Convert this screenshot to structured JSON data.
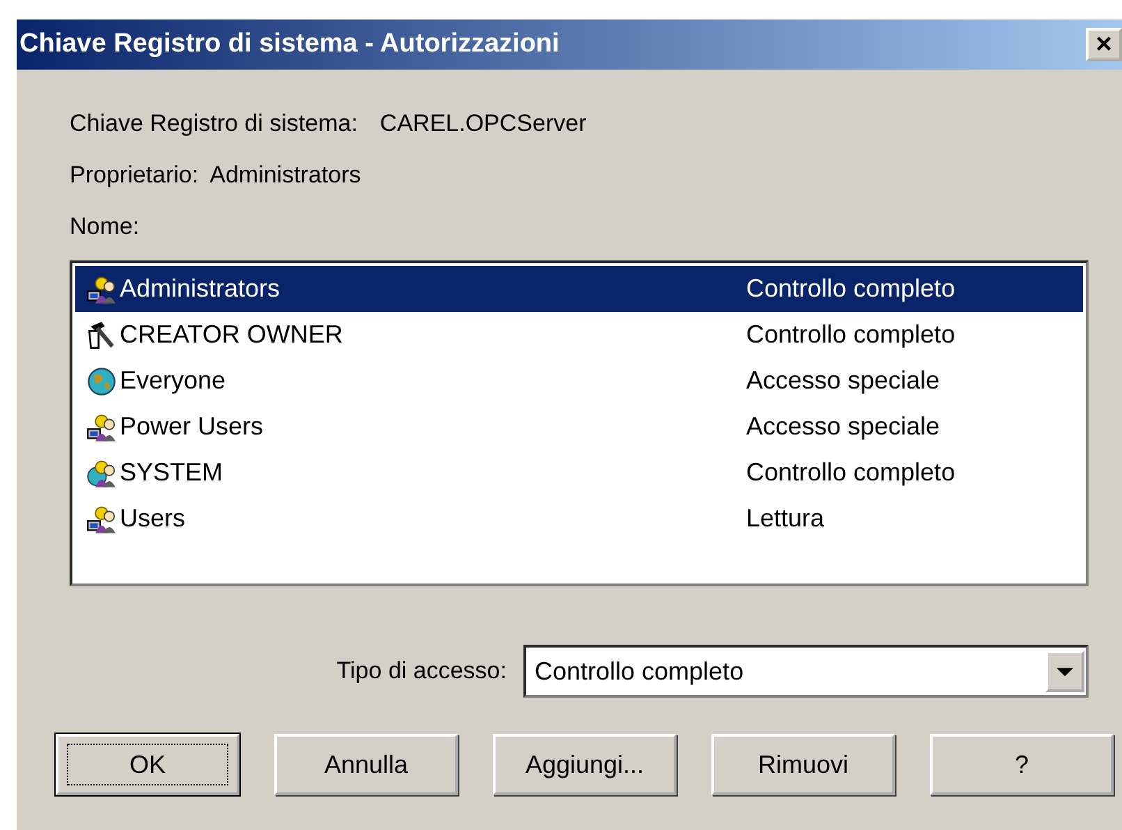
{
  "window": {
    "title": "Chiave Registro di sistema - Autorizzazioni",
    "close": "×"
  },
  "key": {
    "label": "Chiave Registro di sistema:",
    "value": "CAREL.OPCServer"
  },
  "owner": {
    "label": "Proprietario:",
    "value": "Administrators"
  },
  "names_label": "Nome:",
  "accounts": [
    {
      "name": "Administrators",
      "access": "Controllo completo",
      "kind": "group",
      "selected": true
    },
    {
      "name": "CREATOR OWNER",
      "access": "Controllo completo",
      "kind": "creator",
      "selected": false
    },
    {
      "name": "Everyone",
      "access": "Accesso speciale",
      "kind": "everyone",
      "selected": false
    },
    {
      "name": "Power Users",
      "access": "Accesso speciale",
      "kind": "group",
      "selected": false
    },
    {
      "name": "SYSTEM",
      "access": "Controllo completo",
      "kind": "system",
      "selected": false
    },
    {
      "name": "Users",
      "access": "Lettura",
      "kind": "group",
      "selected": false
    }
  ],
  "access_type": {
    "label": "Tipo di accesso:",
    "value": "Controllo completo"
  },
  "buttons": [
    {
      "label": "OK",
      "default": true
    },
    {
      "label": "Annulla",
      "default": false
    },
    {
      "label": "Aggiungi...",
      "default": false
    },
    {
      "label": "Rimuovi",
      "default": false
    },
    {
      "label": "?",
      "default": false
    }
  ]
}
